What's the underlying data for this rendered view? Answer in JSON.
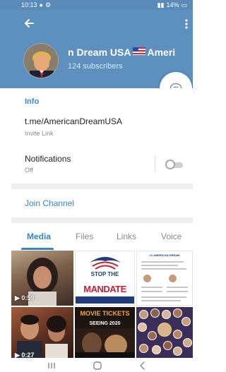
{
  "status_bar": {
    "time": "10:13",
    "battery": "14%"
  },
  "header": {
    "channel_name": "American Dream USA",
    "title_left": "n Dream USA",
    "title_right": "Ameri",
    "subscribers": "124 subscribers",
    "background_color": "#5d8fbf"
  },
  "info": {
    "heading": "Info",
    "link_value": "t.me/AmericanDreamUSA",
    "link_caption": "Invite Link",
    "notifications_label": "Notifications",
    "notifications_value": "Off",
    "notifications_on": false
  },
  "join": {
    "label": "Join Channel"
  },
  "tabs": [
    {
      "label": "Media",
      "active": true
    },
    {
      "label": "Files",
      "active": false
    },
    {
      "label": "Links",
      "active": false
    },
    {
      "label": "Voice",
      "active": false
    }
  ],
  "media": {
    "video1_duration": "0:59",
    "video2_duration": "0:27",
    "poster_stop_title": "STOP THE",
    "poster_stop_big": "MANDATE",
    "flyer_heading": "#1 AMERICAN DREAM",
    "movie_title": "MOVIE TICKETS",
    "movie_sub": "SEEING 2020"
  },
  "colors": {
    "accent": "#3a84c5",
    "header": "#5d8fbf",
    "divider": "#eeeeee"
  },
  "icons": {
    "back": "arrow-left-icon",
    "more": "vertical-dots-icon",
    "comment": "chat-bubble-icon",
    "nav_recents": "recents-icon",
    "nav_home": "home-icon",
    "nav_back": "back-chevron-icon"
  }
}
